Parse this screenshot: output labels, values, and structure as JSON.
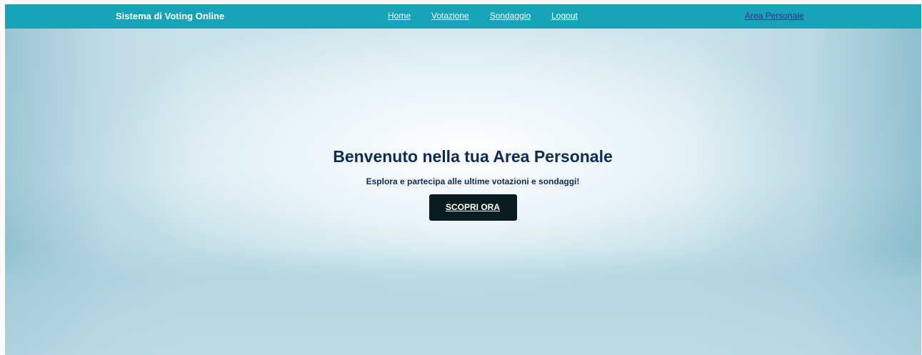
{
  "navbar": {
    "brand": "Sistema di Voting Online",
    "links": [
      {
        "label": "Home"
      },
      {
        "label": "Votazione"
      },
      {
        "label": "Sondaggio"
      },
      {
        "label": "Logout"
      }
    ],
    "area_link": "Area Personale"
  },
  "hero": {
    "title": "Benvenuto nella tua Area Personale",
    "subtitle": "Esplora e partecipa alle ultime votazioni e sondaggi!",
    "cta_label": "SCOPRI ORA"
  },
  "colors": {
    "navbar_bg": "#17a3b8",
    "heading_text": "#0e2a55",
    "button_bg": "#0b1c20",
    "area_link": "#3d2c8f"
  }
}
